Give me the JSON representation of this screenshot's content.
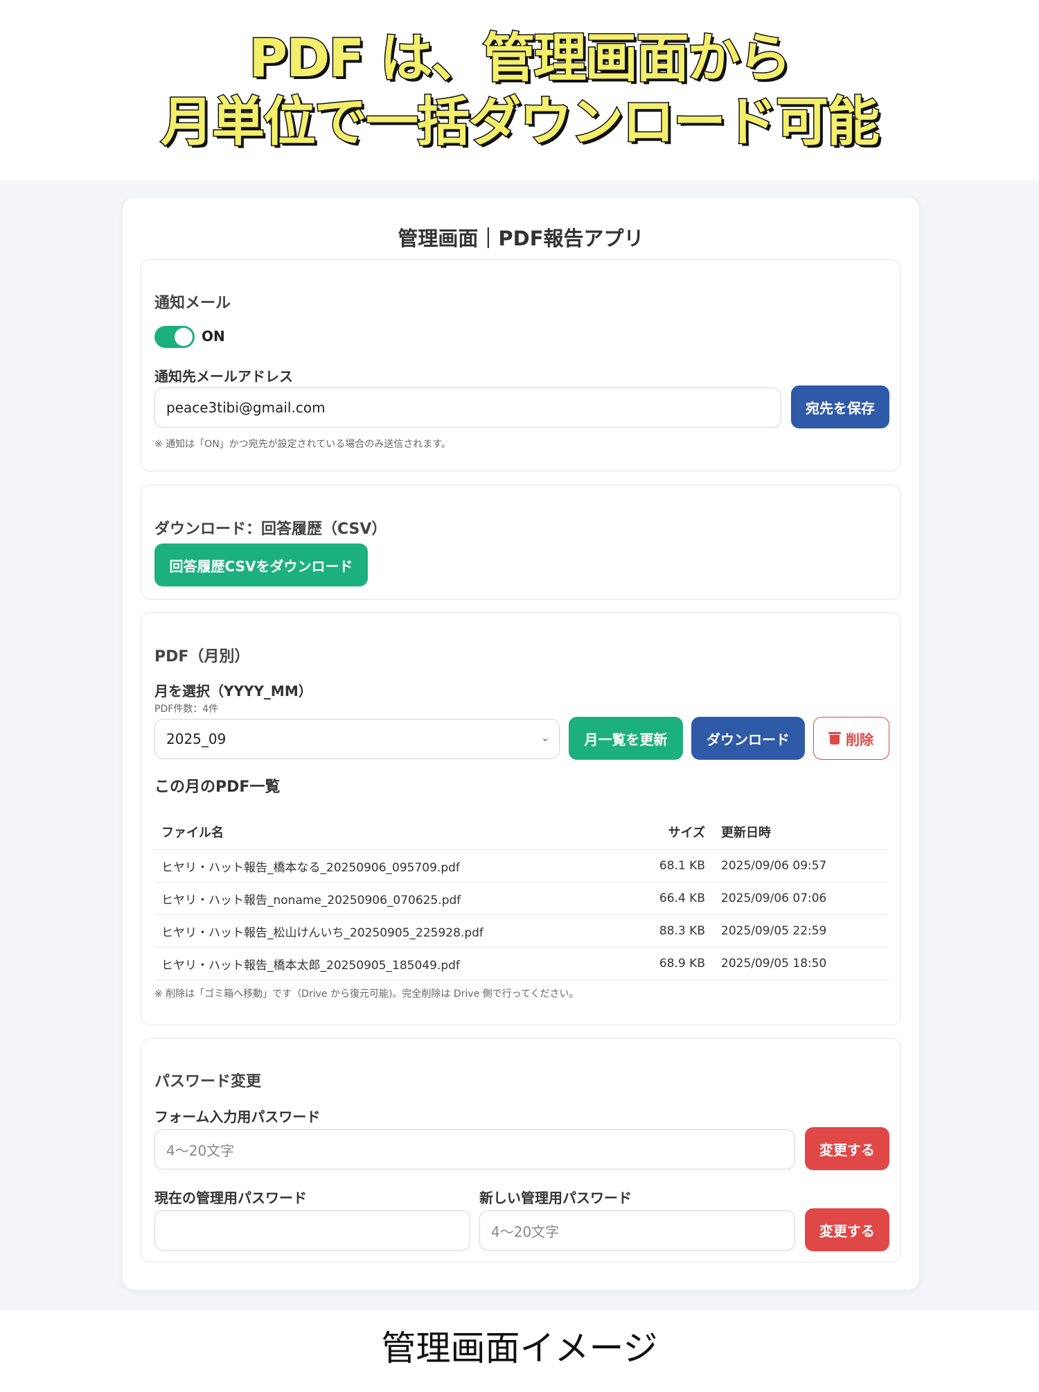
{
  "headline": {
    "line1": "PDF は、管理画面から",
    "line2": "月単位で一括ダウンロード可能"
  },
  "app": {
    "title": "管理画面｜PDF報告アプリ"
  },
  "notify": {
    "section_title": "通知メール",
    "toggle_label": "ON",
    "toggle_on": true,
    "address_label": "通知先メールアドレス",
    "address_value": "peace3tibi@gmail.com",
    "save_label": "宛先を保存",
    "note": "※ 通知は「ON」かつ宛先が設定されている場合のみ送信されます。"
  },
  "csv": {
    "section_title": "ダウンロード：回答履歴（CSV）",
    "button_label": "回答履歴CSVをダウンロード"
  },
  "pdf": {
    "section_title": "PDF（月別）",
    "month_label": "月を選択（YYYY_MM）",
    "count_text": "PDF件数：4件",
    "selected_month": "2025_09",
    "refresh_label": "月一覧を更新",
    "download_label": "ダウンロード",
    "delete_label": "削除",
    "list_title": "この月のPDF一覧",
    "columns": {
      "name": "ファイル名",
      "size": "サイズ",
      "date": "更新日時"
    },
    "rows": [
      {
        "name": "ヒヤリ・ハット報告_橋本なる_20250906_095709.pdf",
        "size": "68.1 KB",
        "date": "2025/09/06 09:57"
      },
      {
        "name": "ヒヤリ・ハット報告_noname_20250906_070625.pdf",
        "size": "66.4 KB",
        "date": "2025/09/06 07:06"
      },
      {
        "name": "ヒヤリ・ハット報告_松山けんいち_20250905_225928.pdf",
        "size": "88.3 KB",
        "date": "2025/09/05 22:59"
      },
      {
        "name": "ヒヤリ・ハット報告_橋本太郎_20250905_185049.pdf",
        "size": "68.9 KB",
        "date": "2025/09/05 18:50"
      }
    ],
    "note": "※ 削除は「ゴミ箱へ移動」です（Drive から復元可能)。完全削除は Drive 側で行ってください。"
  },
  "password": {
    "section_title": "パスワード変更",
    "form_label": "フォーム入力用パスワード",
    "form_placeholder": "4〜20文字",
    "change_label": "変更する",
    "current_label": "現在の管理用パスワード",
    "current_value": "",
    "new_label": "新しい管理用パスワード",
    "new_placeholder": "4〜20文字",
    "change_label_2": "変更する"
  },
  "caption": "管理画面イメージ",
  "colors": {
    "green": "#1db07f",
    "blue": "#2f5aa8",
    "red": "#e04848"
  }
}
